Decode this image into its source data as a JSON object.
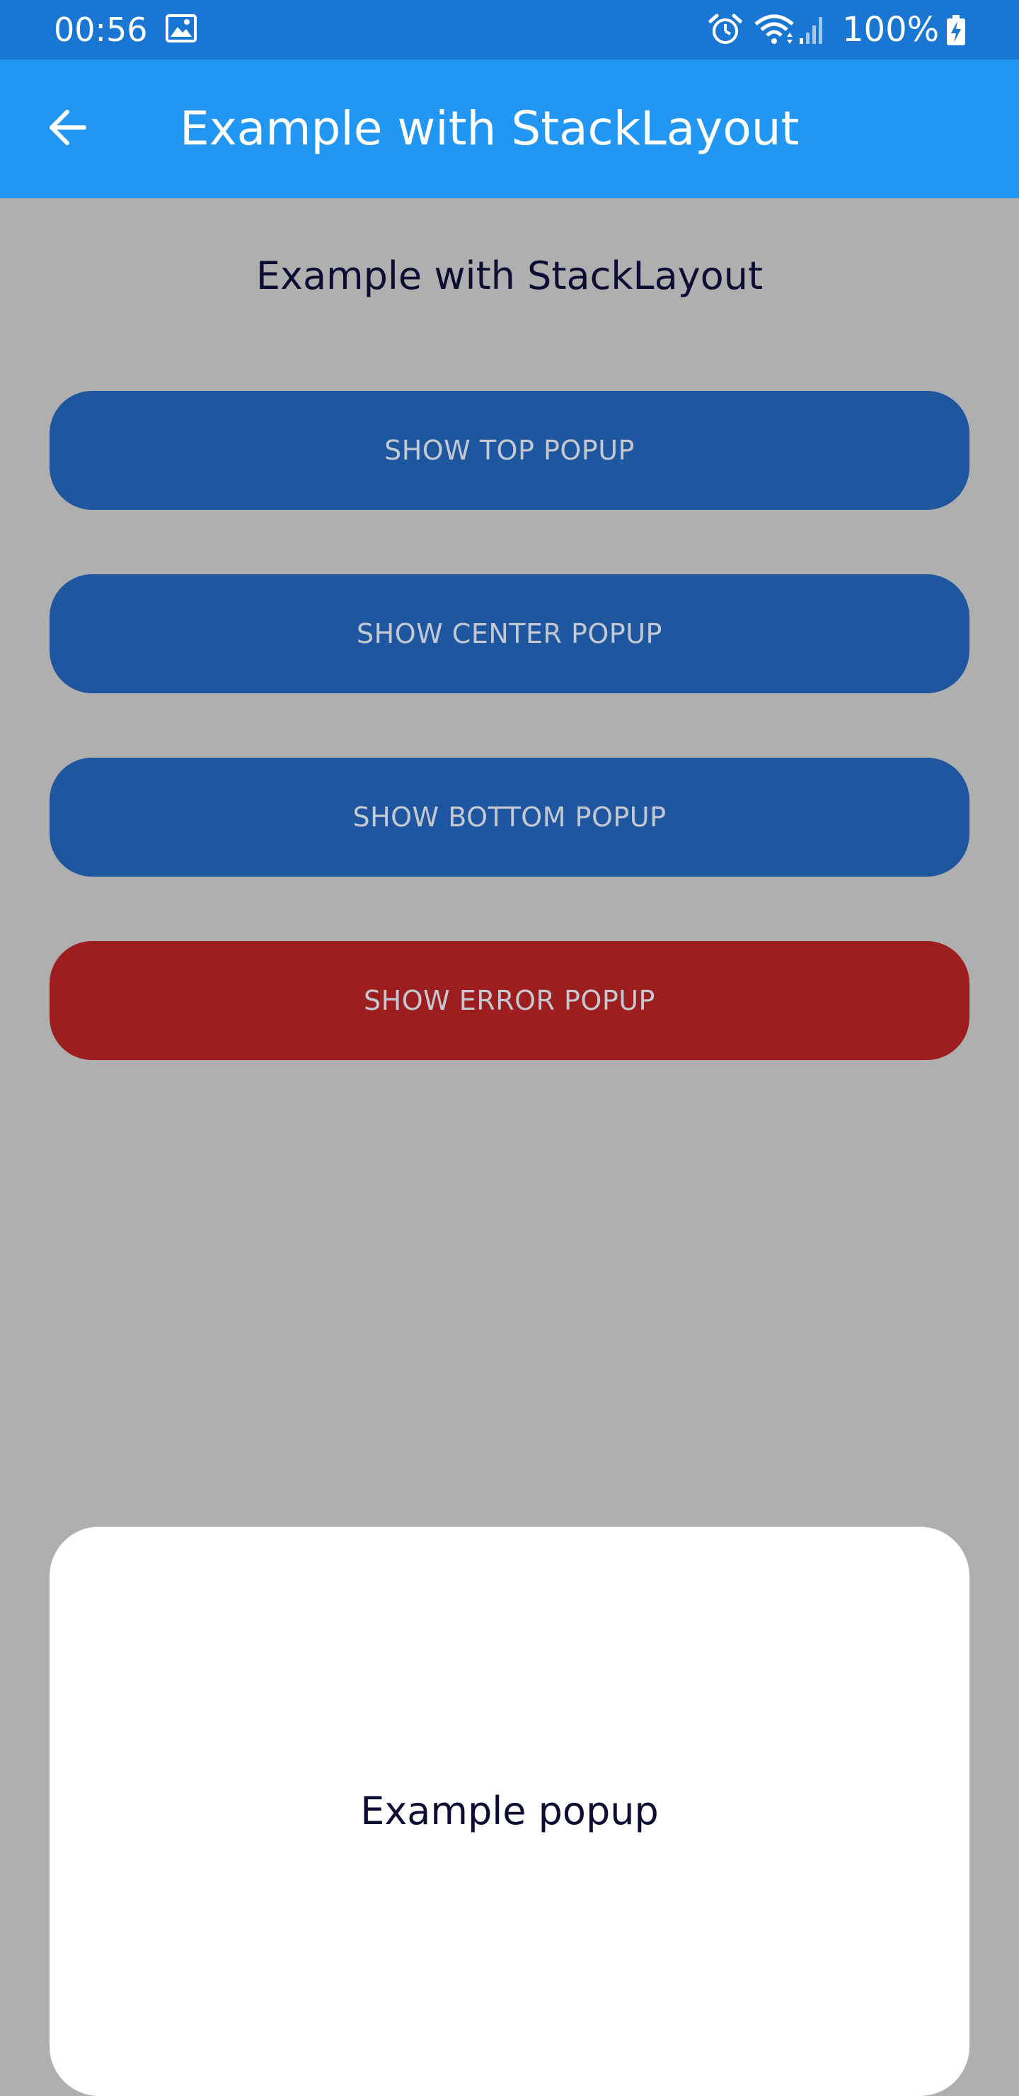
{
  "status_bar": {
    "time": "00:56",
    "battery": "100%",
    "icons": [
      "image-icon",
      "alarm-icon",
      "wifi-icon",
      "signal-icon",
      "battery-charging-icon"
    ]
  },
  "app_bar": {
    "title": "Example with StackLayout",
    "back_icon": "arrow-left-icon"
  },
  "page": {
    "heading": "Example with StackLayout"
  },
  "buttons": {
    "top": "SHOW TOP POPUP",
    "center": "SHOW CENTER POPUP",
    "bottom": "SHOW BOTTOM POPUP",
    "error": "SHOW ERROR POPUP"
  },
  "popup": {
    "text": "Example popup"
  },
  "colors": {
    "status_bar": "#1976d2",
    "app_bar": "#2196f3",
    "background": "#afafaf",
    "button_primary": "#1f56a0",
    "button_error": "#9d1e1f",
    "popup_background": "#ffffff"
  }
}
